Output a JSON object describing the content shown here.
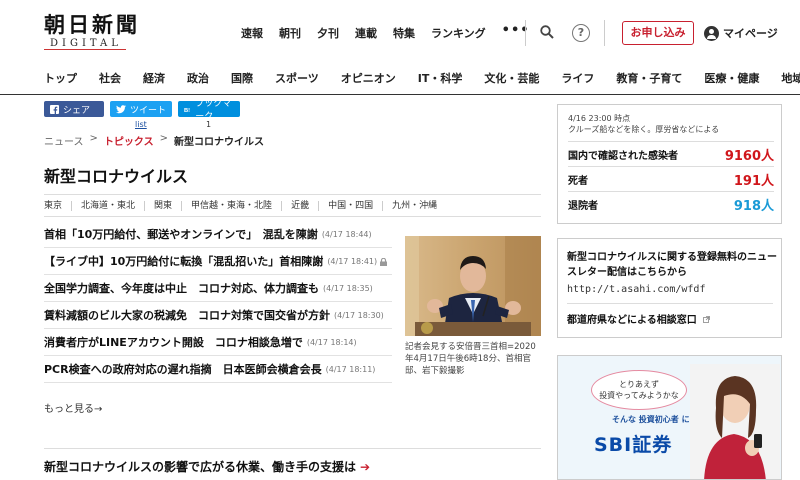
{
  "logo": {
    "main": "朝日新聞",
    "sub": "DIGITAL"
  },
  "topnav": [
    "速報",
    "朝刊",
    "夕刊",
    "連載",
    "特集",
    "ランキング"
  ],
  "topnav_more": "•••",
  "help_glyph": "?",
  "subscribe_label": "お申し込み",
  "mypage_label": "マイページ",
  "categories": [
    "トップ",
    "社会",
    "経済",
    "政治",
    "国際",
    "スポーツ",
    "オピニオン",
    "IT・科学",
    "文化・芸能",
    "ライフ",
    "教育・子育て",
    "医療・健康",
    "地域"
  ],
  "share": {
    "facebook": "シェア",
    "twitter": "ツイート",
    "twitter_count": "list",
    "hatena": "ブックマーク",
    "hatena_count": "1"
  },
  "breadcrumb": {
    "home": "ニュース",
    "sep": ">",
    "section": "トピックス",
    "current": "新型コロナウイルス"
  },
  "page_title": "新型コロナウイルス",
  "regions": [
    "東京",
    "北海道・東北",
    "関東",
    "甲信越・東海・北陸",
    "近畿",
    "中国・四国",
    "九州・沖縄"
  ],
  "headlines": [
    {
      "title": "首相「10万円給付、郵送やオンラインで」　混乱を陳謝",
      "time": "(4/17 18:44)",
      "locked": false
    },
    {
      "title": "【ライブ中】10万円給付に転換「混乱招いた」首相陳謝",
      "time": "(4/17 18:41)",
      "locked": true
    },
    {
      "title": "全国学力調査、今年度は中止　コロナ対応、体力調査も",
      "time": "(4/17 18:35)",
      "locked": false
    },
    {
      "title": "賃料減額のビル大家の税減免　コロナ対策で国交省が方針",
      "time": "(4/17 18:30)",
      "locked": false
    },
    {
      "title": "消費者庁がLINEアカウント開設　コロナ相談急増で",
      "time": "(4/17 18:14)",
      "locked": false
    },
    {
      "title": "PCR検査への政府対応の遅れ指摘　日本医師会横倉会長",
      "time": "(4/17 18:11)",
      "locked": false
    }
  ],
  "photo_caption": "記者会見する安倍晋三首相=2020年4月17日午後6時18分、首相官邸、岩下毅撮影",
  "more_link": "もっと見る→",
  "bottom_headline": "新型コロナウイルスの影響で広がる休業、働き手の支援は",
  "bottom_arrow": "➔",
  "stats": {
    "date": "4/16 23:00 時点",
    "note": "クルーズ船などを除く。厚労省などによる",
    "rows": [
      {
        "label": "国内で確認された感染者",
        "value": "9160人",
        "color": "#d0161b"
      },
      {
        "label": "死者",
        "value": "191人",
        "color": "#d0161b"
      },
      {
        "label": "退院者",
        "value": "918人",
        "color": "#1a9ad6"
      }
    ]
  },
  "newsletter": {
    "text": "新型コロナウイルスに関する登録無料のニュースレター配信はこちらから",
    "url": "http://t.asahi.com/wfdf",
    "consult": "都道府県などによる相談窓口"
  },
  "ad": {
    "bubble_line1": "とりあえず",
    "bubble_line2": "投資やってみようかな",
    "tagline_pre": "そんな",
    "tagline_main": "投資初心者",
    "tagline_post": "には",
    "brand": "SBI証券"
  },
  "colors": {
    "accent": "#c8202f",
    "red_stat": "#d0161b",
    "blue_stat": "#1a9ad6"
  }
}
